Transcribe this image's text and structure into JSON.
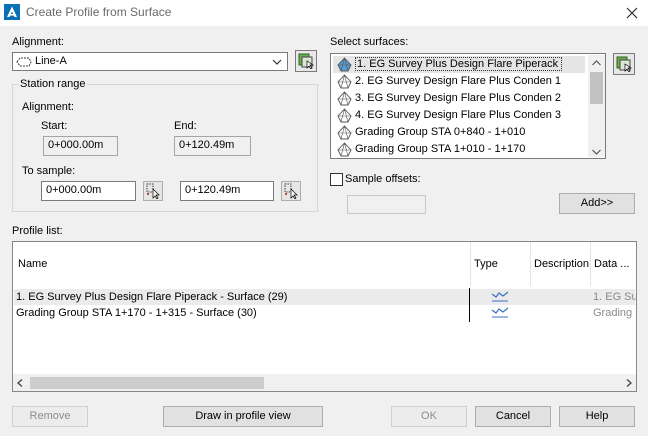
{
  "window": {
    "title": "Create Profile from Surface"
  },
  "alignment": {
    "label": "Alignment:",
    "value": "Line-A"
  },
  "station_range": {
    "group_label": "Station range",
    "alignment_label": "Alignment:",
    "start_label": "Start:",
    "end_label": "End:",
    "start_value": "0+000.00m",
    "end_value": "0+120.49m",
    "to_sample_label": "To sample:",
    "sample_start": "0+000.00m",
    "sample_end": "0+120.49m"
  },
  "surfaces": {
    "label": "Select surfaces:",
    "items": [
      "1. EG Survey Plus Design Flare Piperack",
      "2. EG Survey Design Flare Plus Conden 1",
      "3. EG Survey Design Flare Plus Conden 2",
      "4. EG Survey Design Flare Plus Conden 3",
      "Grading Group STA 0+840 - 1+010",
      "Grading Group STA 1+010 - 1+170"
    ]
  },
  "sample_offsets": {
    "label": "Sample offsets:",
    "checked": false
  },
  "add_button": "Add>>",
  "profile_list": {
    "label": "Profile list:",
    "columns": [
      "Name",
      "Type",
      "Description",
      "Data ..."
    ],
    "rows": [
      {
        "name": "1. EG Survey Plus Design Flare Piperack - Surface (29)",
        "description": "",
        "data": "1. EG Sur"
      },
      {
        "name": "Grading Group STA 1+170 - 1+315 - Surface (30)",
        "description": "",
        "data": "Grading ."
      }
    ]
  },
  "buttons": {
    "remove": "Remove",
    "draw": "Draw in profile view",
    "ok": "OK",
    "cancel": "Cancel",
    "help": "Help"
  },
  "icons": {
    "app": "civil3d-app-icon",
    "close": "close-icon",
    "surface": "surface-icon",
    "pick": "pick-station-icon",
    "select_from_drawing": "select-from-drawing-icon",
    "profile_type": "profile-line-icon"
  }
}
